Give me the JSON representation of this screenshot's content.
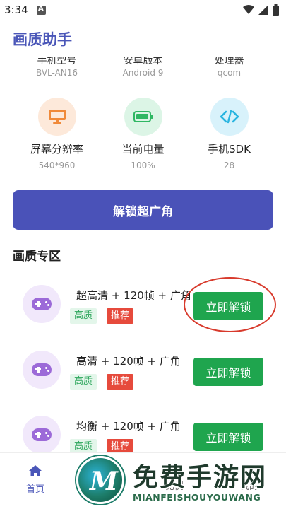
{
  "status_bar": {
    "time": "3:34"
  },
  "app": {
    "title": "画质助手"
  },
  "device_info": [
    {
      "label": "手机型号",
      "value": "BVL-AN16"
    },
    {
      "label": "安卓版本",
      "value": "Android 9"
    },
    {
      "label": "处理器",
      "value": "qcom"
    }
  ],
  "stats": [
    {
      "icon": "monitor-icon",
      "label": "屏幕分辨率",
      "value": "540*960",
      "color": "#f08a3a"
    },
    {
      "icon": "battery-icon",
      "label": "当前电量",
      "value": "100%",
      "color": "#2fb763"
    },
    {
      "icon": "code-icon",
      "label": "手机SDK",
      "value": "28",
      "color": "#2ab5e0"
    }
  ],
  "unlock_wide_label": "解锁超广角",
  "section_title": "画质专区",
  "modes": [
    {
      "name": "超高清 + 120帧 + 广角",
      "tag1": "高质",
      "tag2": "推荐",
      "button": "立即解锁"
    },
    {
      "name": "高清 + 120帧 + 广角",
      "tag1": "高质",
      "tag2": "推荐",
      "button": "立即解锁"
    },
    {
      "name": "均衡 + 120帧 + 广角",
      "tag1": "高质",
      "tag2": "推荐",
      "button": "立即解锁"
    }
  ],
  "nav": {
    "home": "首页",
    "compare": "比例",
    "mine": "我的"
  },
  "watermark": {
    "title": "免费手游网",
    "sub": "MIANFEISHOUYOUWANG"
  },
  "colors": {
    "accent": "#4a52b8",
    "unlock_green": "#1fa54e",
    "recommend_red": "#e64a3c"
  }
}
